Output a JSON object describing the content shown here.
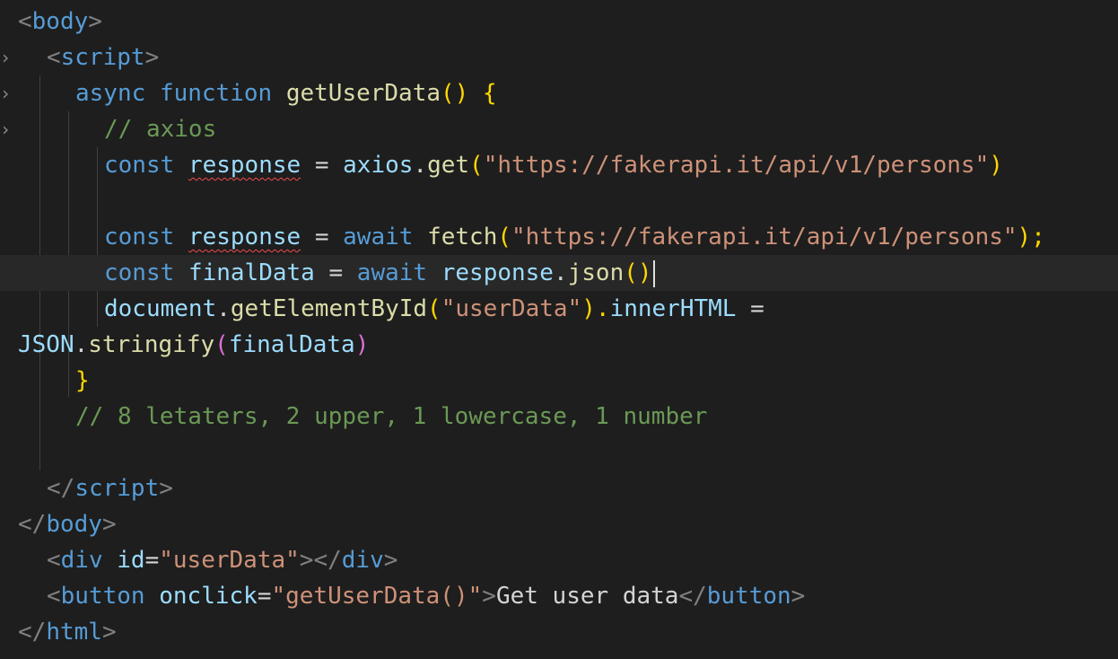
{
  "editor": {
    "language": "html",
    "lines": {
      "l1": {
        "open": "<",
        "tag": "body",
        "close": ">"
      },
      "l2": {
        "open": "<",
        "tag": "script",
        "close": ">"
      },
      "l3": {
        "kw1": "async",
        "kw2": "function",
        "fn": "getUserData",
        "rest": "() {"
      },
      "l4": {
        "comment": "// axios"
      },
      "l5": {
        "kw": "const",
        "var": "response",
        "eq": " = ",
        "obj": "axios",
        "dot": ".",
        "fn": "get",
        "p1": "(",
        "str": "\"https://fakerapi.it/api/v1/persons\"",
        "p2": ")"
      },
      "l7": {
        "kw": "const",
        "var": "response",
        "eq": " = ",
        "await": "await",
        "fn": "fetch",
        "p1": "(",
        "str": "\"https://fakerapi.it/api/v1/persons\"",
        "p2": ");"
      },
      "l8": {
        "kw": "const",
        "var": "finalData",
        "eq": " = ",
        "await": "await",
        "obj": "response",
        "dot": ".",
        "fn": "json",
        "p": "()"
      },
      "l9": {
        "obj": "document",
        "dot": ".",
        "fn": "getElementById",
        "p1": "(",
        "str": "\"userData\"",
        "p2": ").",
        "prop": "innerHTML",
        "eq": " ="
      },
      "l10": {
        "obj": "JSON",
        "dot": ".",
        "fn": "stringify",
        "p1": "(",
        "var": "finalData",
        "p2": ")"
      },
      "l11": {
        "brace": "}"
      },
      "l12": {
        "comment": "// 8 letaters, 2 upper, 1 lowercase, 1 number"
      },
      "l14": {
        "open": "</",
        "tag": "script",
        "close": ">"
      },
      "l15": {
        "open": "</",
        "tag": "body",
        "close": ">"
      },
      "l16": {
        "open": "<",
        "tag": "div",
        "attr": "id",
        "eq": "=",
        "val": "\"userData\"",
        "mid": "></",
        "tag2": "div",
        "close": ">"
      },
      "l17": {
        "open": "<",
        "tag": "button",
        "attr": "onclick",
        "eq": "=",
        "val": "\"getUserData()\"",
        "mid": ">",
        "text": "Get user data",
        "open2": "</",
        "tag2": "button",
        "close": ">"
      },
      "l18": {
        "open": "</",
        "tag": "html",
        "close": ">"
      }
    },
    "fold_marker": "›",
    "colors": {
      "background": "#1e1e1e",
      "tag": "#569cd6",
      "keyword": "#569cd6",
      "function": "#dcdcaa",
      "variable": "#9cdcfe",
      "string": "#ce9178",
      "comment": "#6a9955",
      "text": "#d4d4d4",
      "error_squiggle": "#f14c4c"
    }
  }
}
